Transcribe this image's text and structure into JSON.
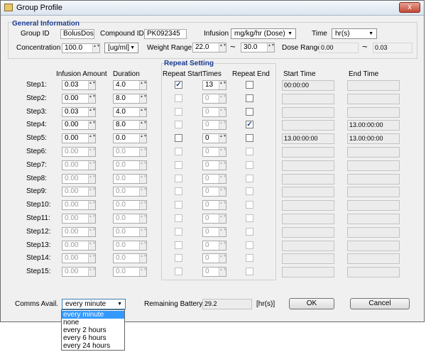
{
  "window": {
    "title": "Group Profile",
    "close_label": "x"
  },
  "general": {
    "section_title": "General Information",
    "group_id_label": "Group ID",
    "group_id_value": "BolusDoseR",
    "compound_id_label": "Compound ID",
    "compound_id_value": "PK092345",
    "infusion_label": "Infusion",
    "infusion_unit": "mg/kg/hr (Dose)",
    "time_label": "Time",
    "time_unit": "hr(s)",
    "concentration_label": "Concentration",
    "concentration_value": "100.0",
    "concentration_unit": "[ug/ml]",
    "weight_range_label": "Weight Range",
    "weight_min": "22.0",
    "weight_sep": "~",
    "weight_max": "30.0",
    "dose_range_label": "Dose Range",
    "dose_min": "0.00",
    "dose_sep": "~",
    "dose_max": "0.03"
  },
  "headers": {
    "infusion_amount": "Infusion Amount",
    "duration": "Duration",
    "repeat_setting": "Repeat Setting",
    "repeat_start": "Repeat Start",
    "times": "Times",
    "repeat_end": "Repeat End",
    "start_time": "Start Time",
    "end_time": "End Time"
  },
  "steps": [
    {
      "label": "Step1:",
      "amount": "0.03",
      "duration": "4.0",
      "repeat_start": true,
      "times": "13",
      "repeat_end": false,
      "start": "00:00:00",
      "end": "",
      "enabled": true
    },
    {
      "label": "Step2:",
      "amount": "0.00",
      "duration": "8.0",
      "repeat_start": false,
      "times": "0",
      "repeat_end": false,
      "start": "",
      "end": "",
      "enabled": true
    },
    {
      "label": "Step3:",
      "amount": "0.03",
      "duration": "4.0",
      "repeat_start": false,
      "times": "0",
      "repeat_end": false,
      "start": "",
      "end": "",
      "enabled": true
    },
    {
      "label": "Step4:",
      "amount": "0.00",
      "duration": "8.0",
      "repeat_start": false,
      "times": "0",
      "repeat_end": true,
      "start": "",
      "end": "13.00:00:00",
      "enabled": true
    },
    {
      "label": "Step5:",
      "amount": "0.00",
      "duration": "0.0",
      "repeat_start": false,
      "times": "0",
      "repeat_end": false,
      "start": "13.00:00:00",
      "end": "13.00:00:00",
      "enabled": true
    },
    {
      "label": "Step6:",
      "amount": "0.00",
      "duration": "0.0",
      "repeat_start": false,
      "times": "0",
      "repeat_end": false,
      "start": "",
      "end": "",
      "enabled": false
    },
    {
      "label": "Step7:",
      "amount": "0.00",
      "duration": "0.0",
      "repeat_start": false,
      "times": "0",
      "repeat_end": false,
      "start": "",
      "end": "",
      "enabled": false
    },
    {
      "label": "Step8:",
      "amount": "0.00",
      "duration": "0.0",
      "repeat_start": false,
      "times": "0",
      "repeat_end": false,
      "start": "",
      "end": "",
      "enabled": false
    },
    {
      "label": "Step9:",
      "amount": "0.00",
      "duration": "0.0",
      "repeat_start": false,
      "times": "0",
      "repeat_end": false,
      "start": "",
      "end": "",
      "enabled": false
    },
    {
      "label": "Step10:",
      "amount": "0.00",
      "duration": "0.0",
      "repeat_start": false,
      "times": "0",
      "repeat_end": false,
      "start": "",
      "end": "",
      "enabled": false
    },
    {
      "label": "Step11:",
      "amount": "0.00",
      "duration": "0.0",
      "repeat_start": false,
      "times": "0",
      "repeat_end": false,
      "start": "",
      "end": "",
      "enabled": false
    },
    {
      "label": "Step12:",
      "amount": "0.00",
      "duration": "0.0",
      "repeat_start": false,
      "times": "0",
      "repeat_end": false,
      "start": "",
      "end": "",
      "enabled": false
    },
    {
      "label": "Step13:",
      "amount": "0.00",
      "duration": "0.0",
      "repeat_start": false,
      "times": "0",
      "repeat_end": false,
      "start": "",
      "end": "",
      "enabled": false
    },
    {
      "label": "Step14:",
      "amount": "0.00",
      "duration": "0.0",
      "repeat_start": false,
      "times": "0",
      "repeat_end": false,
      "start": "",
      "end": "",
      "enabled": false
    },
    {
      "label": "Step15:",
      "amount": "0.00",
      "duration": "0.0",
      "repeat_start": false,
      "times": "0",
      "repeat_end": false,
      "start": "",
      "end": "",
      "enabled": false
    }
  ],
  "footer": {
    "comms_label": "Comms Avail.",
    "comms_value": "every  minute",
    "comms_options": [
      "every  minute",
      "none",
      "every  2 hours",
      "every  6 hours",
      "every 24 hours"
    ],
    "battery_label": "Remaining Battery",
    "battery_value": "29.2",
    "battery_unit": "[hr(s)]",
    "ok_label": "OK",
    "cancel_label": "Cancel"
  },
  "icons": {
    "check_glyph": "✓",
    "spin_glyph": "▲▼",
    "dropdown_glyph": "▼"
  }
}
